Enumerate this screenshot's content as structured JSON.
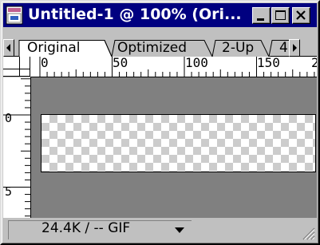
{
  "window": {
    "title": "Untitled-1 @ 100% (Ori...",
    "icon": "document-app-icon",
    "controls": [
      "minimize-icon",
      "maximize-icon",
      "close-icon"
    ]
  },
  "tabs": {
    "items": [
      {
        "label": "Original",
        "active": true
      },
      {
        "label": "Optimized",
        "active": false
      },
      {
        "label": "2-Up",
        "active": false
      },
      {
        "label": "4",
        "active": false
      }
    ],
    "scroll_left_icon": "left-arrow-icon",
    "scroll_right_icon": "right-arrow-icon"
  },
  "ruler": {
    "horizontal_labels": [
      "0",
      "50",
      "100",
      "150",
      "2"
    ],
    "vertical_labels": [
      "0",
      "5"
    ]
  },
  "canvas": {
    "background_color": "#808080",
    "transparency_pattern": "checkerboard"
  },
  "status": {
    "text": "24.4K / -- GIF",
    "dropdown_icon": "dropdown-arrow-icon"
  }
}
